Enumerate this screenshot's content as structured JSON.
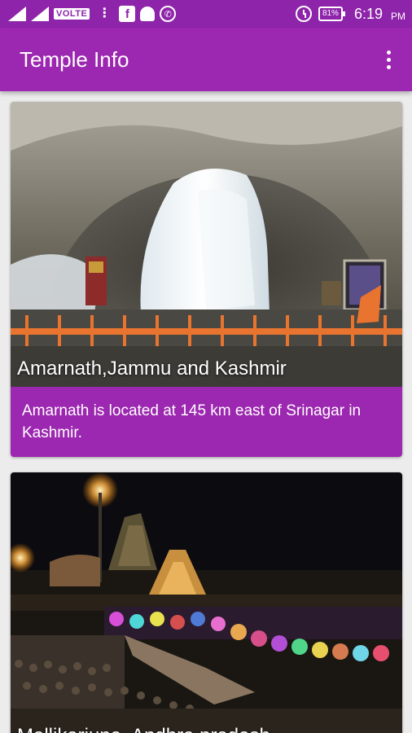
{
  "status_bar": {
    "network": "VOLTE",
    "battery": "81%",
    "time": "6:19",
    "ampm": "PM",
    "icons": [
      "signal-icon",
      "signal-icon",
      "more-vert-icon",
      "facebook-icon",
      "snapchat-icon",
      "whatsapp-icon",
      "alarm-icon",
      "battery-icon"
    ]
  },
  "app_bar": {
    "title": "Temple Info",
    "menu_icon": "overflow-menu-icon"
  },
  "temples": [
    {
      "name": "Amarnath,Jammu and Kashmir",
      "description": "Amarnath is located at 145 km east of Srinagar in Kashmir."
    },
    {
      "name": "Mallikarjuna, Andhra pradesh"
    }
  ],
  "colors": {
    "primary": "#9c27b0",
    "primary_dark": "#8e24aa",
    "background": "#ececec"
  }
}
